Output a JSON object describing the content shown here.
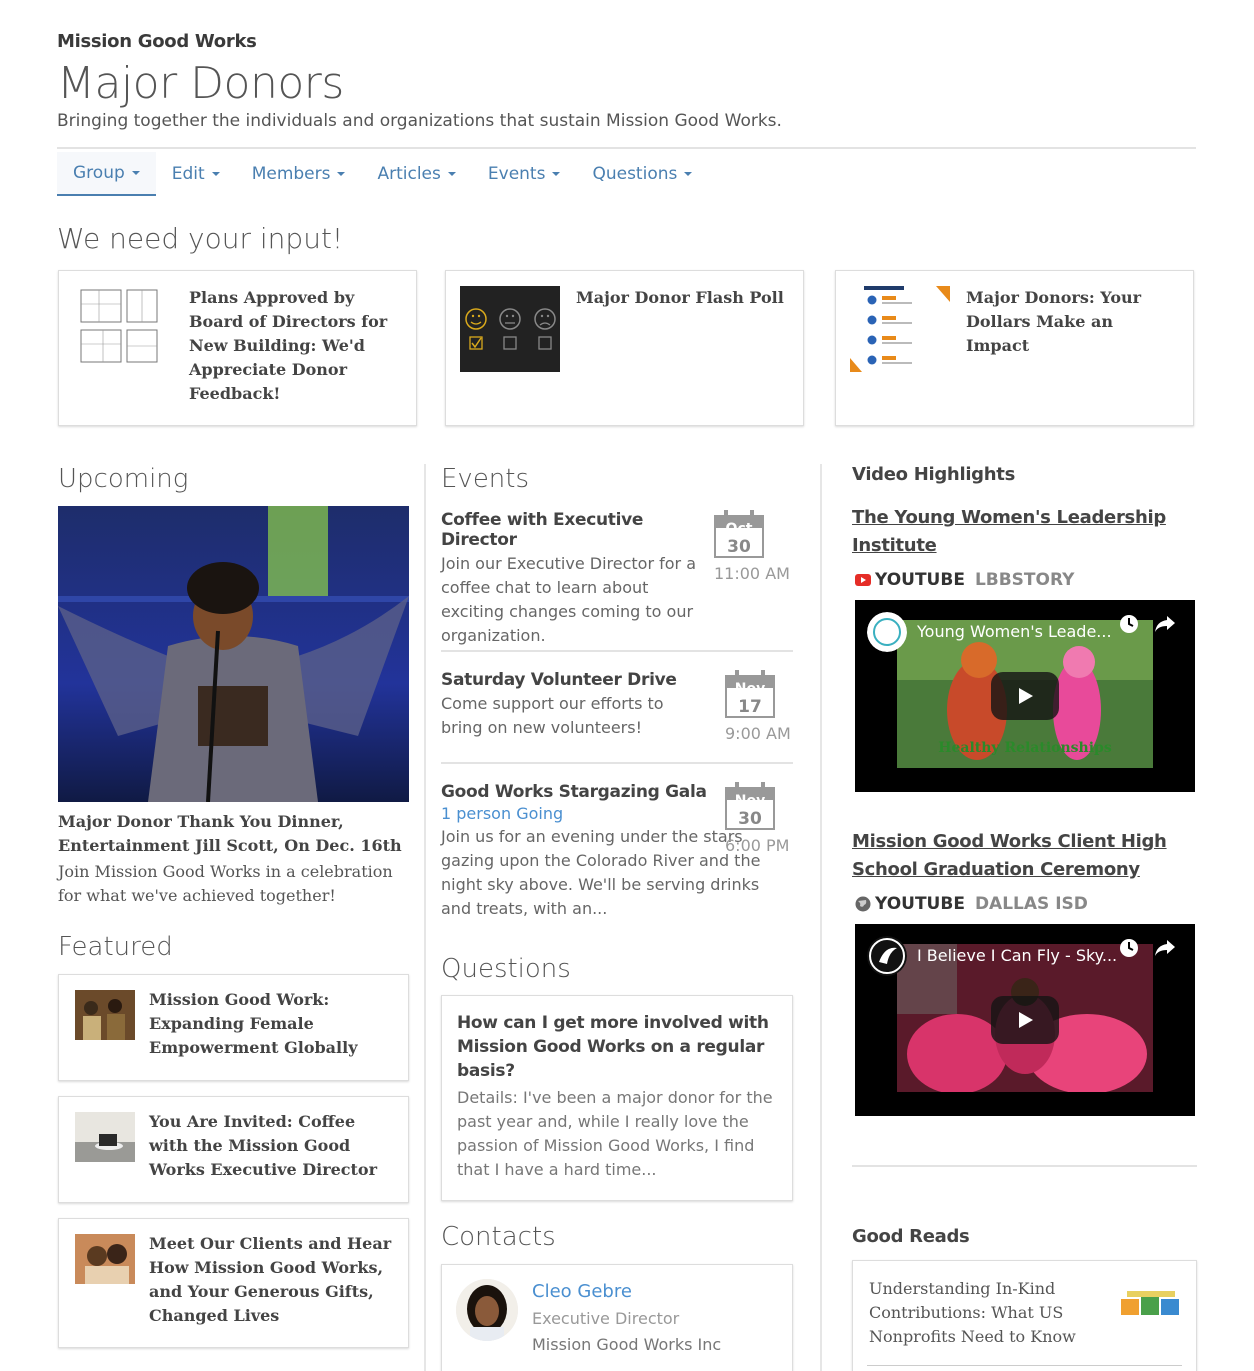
{
  "header": {
    "org": "Mission Good Works",
    "title": "Major Donors",
    "subtitle": "Bringing together the individuals and organizations that sustain Mission Good Works."
  },
  "nav": [
    "Group",
    "Edit",
    "Members",
    "Articles",
    "Events",
    "Questions"
  ],
  "input_section": {
    "heading": "We need your input!",
    "cards": [
      {
        "title": "Plans Approved by Board of Directors for New Building: We'd Appreciate Donor Feedback!",
        "thumb": "floorplan-icon"
      },
      {
        "title": "Major Donor Flash Poll",
        "thumb": "smiley-poll-icon"
      },
      {
        "title": "Major Donors: Your Dollars Make an Impact",
        "thumb": "results-infographic"
      }
    ]
  },
  "upcoming": {
    "heading": "Upcoming",
    "title": "Major Donor Thank You Dinner, Entertainment Jill Scott, On Dec. 16th",
    "desc": "Join Mission Good Works in a celebration for what we've achieved together!"
  },
  "featured": {
    "heading": "Featured",
    "items": [
      {
        "title": "Mission Good Work: Expanding Female Empowerment Globally"
      },
      {
        "title": "You Are Invited: Coffee with the Mission Good Works Executive Director"
      },
      {
        "title": "Meet Our Clients and Hear How Mission Good Works, and Your Generous Gifts, Changed Lives"
      }
    ]
  },
  "events": {
    "heading": "Events",
    "items": [
      {
        "title": "Coffee with Executive Director",
        "desc": "Join our Executive Director for a coffee chat to learn about exciting changes coming to our organization.",
        "month": "Oct",
        "day": "30",
        "time": "11:00 AM"
      },
      {
        "title": "Saturday Volunteer Drive",
        "desc": "Come support our efforts to bring on new volunteers!",
        "month": "Nov",
        "day": "17",
        "time": "9:00 AM"
      },
      {
        "title": "Good Works Stargazing Gala",
        "going": "1 person Going",
        "desc": "Join us for an evening under the stars gazing upon the Colorado River and the night sky above. We'll be serving drinks and treats, with an...",
        "month": "Nov",
        "day": "30",
        "time": "6:00 PM"
      }
    ]
  },
  "questions": {
    "heading": "Questions",
    "title": "How can I get more involved with Mission Good Works on a regular basis?",
    "desc": "Details: I've been a major donor for the past year and, while I really love the passion of Mission Good Works, I find that I have a hard time..."
  },
  "contacts": {
    "heading": "Contacts",
    "name": "Cleo Gebre",
    "role": "Executive Director",
    "org": "Mission Good Works Inc"
  },
  "videos": {
    "heading": "Video Highlights",
    "items": [
      {
        "link": "The Young Women's Leadership Institute",
        "source": "YOUTUBE",
        "channel": "LBBSTORY",
        "player_title": "Young Women's Leade...",
        "overlay": "Healthy Relationships"
      },
      {
        "link": "Mission Good Works Client High School Graduation Ceremony",
        "source": "YOUTUBE",
        "channel": "DALLAS ISD",
        "player_title": "I Believe I Can Fly - Sky..."
      }
    ]
  },
  "good_reads": {
    "heading": "Good Reads",
    "title": "Understanding In-Kind Contributions: What US Nonprofits Need to Know"
  },
  "colors": {
    "link": "#4a7fb0",
    "accent_blue": "#4a8fd0",
    "youtube_red": "#e52d27"
  }
}
